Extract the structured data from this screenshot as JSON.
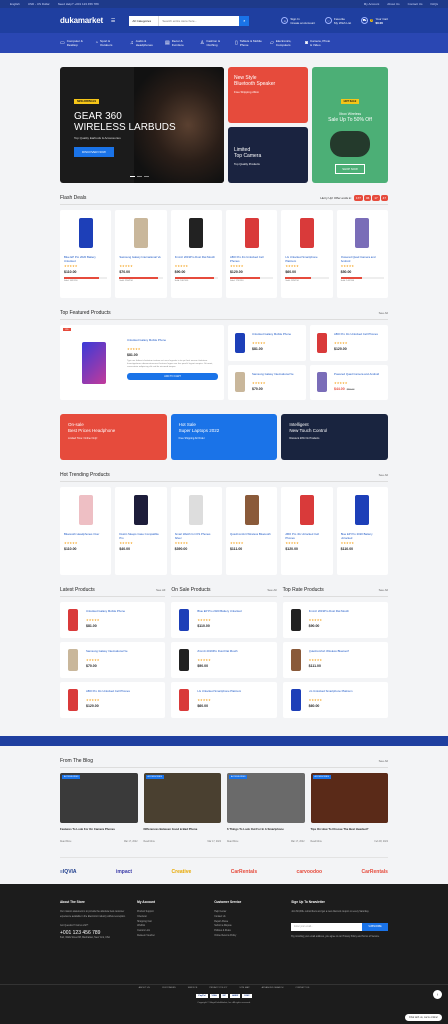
{
  "topbar": {
    "language": "English",
    "currency": "USD - US Dollar",
    "help": "Need Help? +001 123 456 789",
    "links": [
      "My Account",
      "About Us",
      "Contact Us",
      "FAQs"
    ]
  },
  "header": {
    "logo": "dukamarket",
    "search_category": "All Categories",
    "search_placeholder": "Search entire store here...",
    "account_top": "Sign In",
    "account_bottom": "Create an Account",
    "wishlist_top": "Favorite",
    "wishlist_bottom": "My Wish List",
    "cart_count": "0",
    "cart_top": "Your Cart",
    "cart_total": "$0.00"
  },
  "nav": [
    {
      "icon": "monitor-icon",
      "glyph": "▭",
      "label": "Computer & Desktop"
    },
    {
      "icon": "sport-icon",
      "glyph": "◔",
      "label": "Sport & Outdoors"
    },
    {
      "icon": "headphones-icon",
      "glyph": "♫",
      "label": "Audio & Headphones"
    },
    {
      "icon": "furniture-icon",
      "glyph": "▤",
      "label": "Decor & Furniture"
    },
    {
      "icon": "clothing-icon",
      "glyph": "♙",
      "label": "Fashion & Clothing"
    },
    {
      "icon": "tablet-icon",
      "glyph": "▯",
      "label": "Tablets & Mobile Phone"
    },
    {
      "icon": "laptop-icon",
      "glyph": "▱",
      "label": "Electronics, Computers"
    },
    {
      "icon": "camera-icon",
      "glyph": "◙",
      "label": "Camera, Photo & Video"
    }
  ],
  "hero": {
    "badge": "NEW ARRIVALS",
    "title_line1": "GEAR 360",
    "title_line2": "WIRELESS LARBUDS",
    "subtitle": "Top Quality Earbuds & Accessories",
    "button": "DISCOVER NOW",
    "tile1_title1": "New Style",
    "tile1_title2": "Bluetooth Speaker",
    "tile1_sub": "Free Shipping 24km",
    "tile2_title1": "Limited",
    "tile2_title2": "Top Camera",
    "tile2_sub": "Top Quality Products",
    "tile3_badge": "HOT SALE",
    "tile3_title1": "Xbox Wireless",
    "tile3_title2": "Sale Up To 50% Off",
    "tile3_button": "SHOP NOW"
  },
  "flash": {
    "title": "Flash Deals",
    "hurry": "Hurry Up! Offer ends in:",
    "countdown": [
      "177",
      "06",
      "17",
      "47"
    ],
    "products": [
      {
        "name": "Blue EP Pro 2020 Battery Unlocked",
        "price": "$110.00",
        "sold": "Sold: 163/150",
        "progress": 0.8,
        "color": "#1d3fb8"
      },
      {
        "name": "Samsung Galaxy International Ve",
        "price": "$70.00",
        "sold": "Sold: 150/150",
        "progress": 0.9,
        "color": "#c9b79b"
      },
      {
        "name": "Zmmzi 2019Pro Dust Flat Mouth",
        "price": "$90.00",
        "sold": "Sold: 180/100",
        "progress": 0.9,
        "color": "#222"
      },
      {
        "name": "ABO Pro 4G Unlocked Cell Phones",
        "price": "$120.00",
        "sold": "Sold: 176/150",
        "progress": 0.7,
        "color": "#d93a3a"
      },
      {
        "name": "LG Unlocked Smartphone Platinum",
        "price": "$60.00",
        "sold": "Sold: 185/150",
        "progress": 0.6,
        "color": "#d93a3a"
      },
      {
        "name": "Powered Quad Camera and Android",
        "price": "$50.00",
        "sold": "Sold: 144/150",
        "progress": 0.5,
        "color": "#7a6db8"
      }
    ]
  },
  "featured": {
    "title": "Top Featured Products",
    "seeall": "See All",
    "big": {
      "badge": "-9%",
      "name": "Unlocked Galaxy Mobile Phone",
      "price": "$81.00",
      "desc": "Typi non habent claritatem insitam est usus legentis in iis qui facit eorum claritatem. Investigationes demonstraverunt lectores legere me lius quod ii legunt saepius. Sit amet, consectetur adipiscing elit sed do eiusmod tempor.",
      "button": "ADD TO CART"
    },
    "minis": [
      {
        "name": "Unlocked Galaxy Mobile Phone",
        "price": "$81.00",
        "color": "#1d3fb8"
      },
      {
        "name": "ABO Pro 4G Unlocked Cell Phones",
        "price": "$120.00",
        "color": "#d93a3a"
      },
      {
        "name": "Samsung Galaxy International Ve",
        "price": "$70.00",
        "color": "#c9b79b"
      },
      {
        "name": "Powered Quad Camera and Android",
        "price": "$44.00",
        "old": "$50.00",
        "color": "#7a6db8"
      }
    ]
  },
  "banners": [
    {
      "t1": "On-sale",
      "t2": "Best Prices Headphone",
      "t3": "Limited Time: Online Only!"
    },
    {
      "t1": "Hot Sale",
      "t2": "Super Laptops 2022",
      "t3": "Free Shipping All Order"
    },
    {
      "t1": "Intelligent",
      "t2": "New Touch Control",
      "t3": "Discount 20% On Products"
    }
  ],
  "trending": {
    "title": "Hot Trending Products",
    "seeall": "See All",
    "products": [
      {
        "name": "Bluetooth Headphones Over",
        "price": "$110.00",
        "color": "#eebfc4"
      },
      {
        "name": "Dustin Sleeps Case Compatible Pro",
        "price": "$40.00",
        "color": "#1d1d3a"
      },
      {
        "name": "Smart Watch for iOS Phones Silver",
        "price": "$390.00",
        "color": "#ddd"
      },
      {
        "name": "QuietComfort Wireless Bluetooth",
        "price": "$111.00",
        "color": "#8a5a3a"
      },
      {
        "name": "ABO Pro 4G Unlocked Cell Phones",
        "price": "$120.00",
        "color": "#d93a3a"
      },
      {
        "name": "Blue EP Pro 2020 Battery Unlocked",
        "price": "$110.00",
        "color": "#1d3fb8"
      }
    ]
  },
  "lists": [
    {
      "title": "Latest Products",
      "seeall": "See All",
      "items": [
        {
          "name": "Unlocked Galaxy Mobile Phone",
          "price": "$81.00",
          "color": "#d93a3a"
        },
        {
          "name": "Samsung Galaxy International Ve",
          "price": "$70.00",
          "color": "#c9b79b"
        },
        {
          "name": "ABO Pro 4G Unlocked Cell Phones",
          "price": "$120.00",
          "color": "#d93a3a"
        }
      ]
    },
    {
      "title": "On Sale Products",
      "seeall": "See All",
      "items": [
        {
          "name": "Blue EP Pro 2020 Battery Unlocked",
          "price": "$110.00",
          "color": "#1d3fb8"
        },
        {
          "name": "Zmmzi 2019Pro Dust Flat Mouth",
          "price": "$90.00",
          "color": "#222"
        },
        {
          "name": "LG Unlocked Smartphone Platinum",
          "price": "$60.00",
          "color": "#d93a3a"
        }
      ]
    },
    {
      "title": "Top Rate Products",
      "seeall": "See All",
      "items": [
        {
          "name": "Zmmzi 2019Pro Dust Flat Mouth",
          "price": "$90.00",
          "color": "#222"
        },
        {
          "name": "QuietComfort Wireless Bluetooth",
          "price": "$111.00",
          "color": "#8a5a3a"
        },
        {
          "name": "LG Unlocked Smartphone Platinum",
          "price": "$60.00",
          "color": "#1d3fb8"
        }
      ]
    }
  ],
  "blog": {
    "title": "From The Blog",
    "seeall": "See All",
    "posts": [
      {
        "cat": "ACCESSORIES",
        "title": "Features To Look For On Camera Phones",
        "read": "Read More",
        "date": "Mar 17, 2022",
        "color": "#3a3a3a"
      },
      {
        "cat": "ACCESSORIES",
        "title": "Differences Between Good & Bad Phone",
        "read": "Read More",
        "date": "Mar 17, 2022",
        "color": "#4a4030"
      },
      {
        "cat": "ACCESSORIES",
        "title": "6 Things To Look Out For In A Smartphone",
        "read": "Read More",
        "date": "Mar 17, 2022",
        "color": "#6a6a6a"
      },
      {
        "cat": "ACCESSORIES",
        "title": "Tips On How To Choose The Best Headset?",
        "read": "Read More",
        "date": "Feb 08, 2022",
        "color": "#5a2a18"
      }
    ]
  },
  "brands": [
    {
      "name": "≡IQVIA",
      "color": "#1a3a8a"
    },
    {
      "name": "impact",
      "color": "#3a3aa8"
    },
    {
      "name": "Creative",
      "color": "#e8a800"
    },
    {
      "name": "CarRentals",
      "color": "#e64b3c"
    },
    {
      "name": "carvoodoo",
      "color": "#e64b3c"
    },
    {
      "name": "CarRentals",
      "color": "#e64b3c"
    }
  ],
  "footer": {
    "about_title": "About The Store",
    "about_text": "Our mission statement is to provide the absolute best customer experience available in the Electronic industry without exception.",
    "call_label": "Got Question? Call us 24/7!",
    "phone": "+001 123 456 789",
    "address": "64A, Walls Street 88, Manhattan, New York, USA",
    "account_title": "My Account",
    "account_links": [
      "Product Support",
      "Checkout",
      "Shopping Cart",
      "Wishlist",
      "Custom Link",
      "Redeem Voucher"
    ],
    "service_title": "Customer Service",
    "service_links": [
      "Help Center",
      "Contact Us",
      "Report Abuse",
      "Submit a Dispute",
      "Policies & Rules",
      "Online Returns Policy"
    ],
    "news_title": "Sign Up To Newsletter",
    "news_text": "Join 60,000+ subscribers and get a new discount coupon on every Saturday.",
    "email_placeholder": "Enter your email...",
    "subscribe": "SUBSCRIBE",
    "agree": "By providing your email address, you agree to our Privacy Policy and Terms of Service.",
    "links": [
      "ABOUT US",
      "CUSTOMERS",
      "SERVICE",
      "PRIVACY POLICY",
      "SITE MAP",
      "ADVANCED SEARCH",
      "CONTACT US"
    ],
    "payments": [
      "PayPal",
      "VISA",
      "MC",
      "AMEX",
      "DISC"
    ],
    "copyright": "Copyright © MagicDukaMarket, Inc. All rights reserved."
  },
  "chat": "Chat with us, we're online!"
}
